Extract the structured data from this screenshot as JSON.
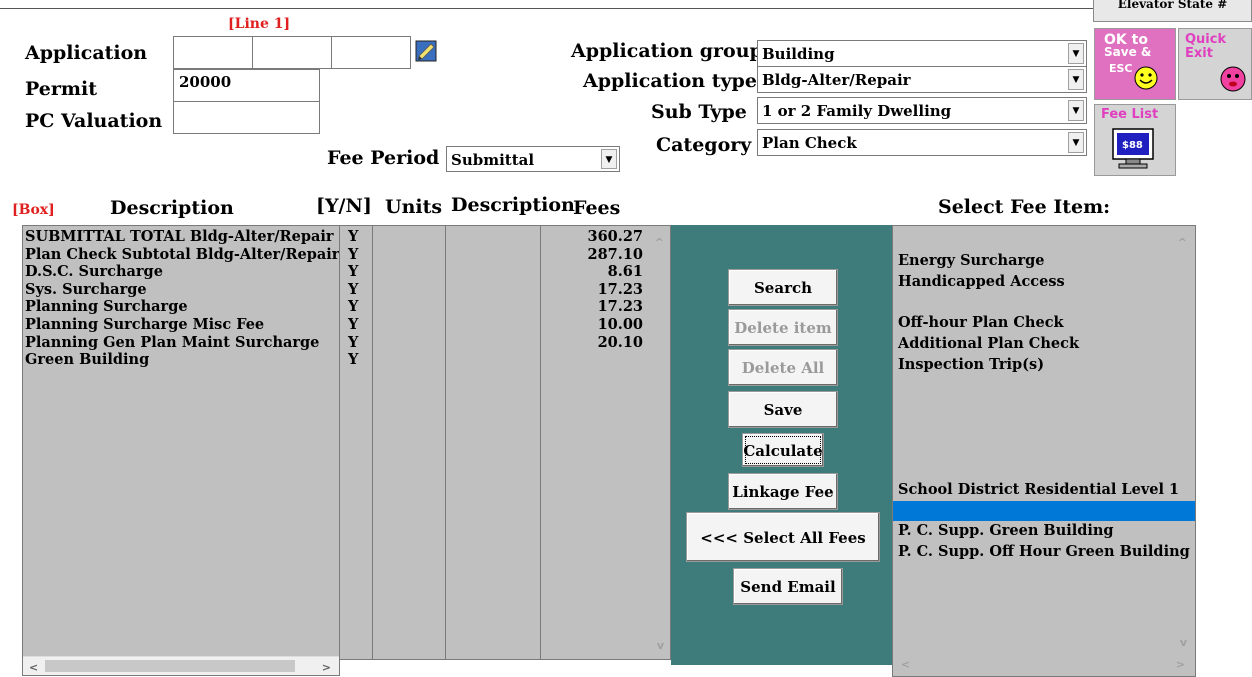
{
  "header": {
    "line1": "[Line 1]",
    "elevator_label": "Elevator State #"
  },
  "form": {
    "application_label": "Application",
    "permit_label": "Permit",
    "permit_value": "20000",
    "pc_valuation_label": "PC Valuation",
    "pc_valuation_value": "",
    "application_group_label": "Application group",
    "application_group_value": "Building",
    "application_type_label": "Application type",
    "application_type_value": "Bldg-Alter/Repair",
    "sub_type_label": "Sub Type",
    "sub_type_value": "1 or 2 Family Dwelling",
    "category_label": "Category",
    "category_value": "Plan Check",
    "fee_period_label": "Fee Period",
    "fee_period_value": "Submittal"
  },
  "side_buttons": {
    "ok_label_1": "OK to",
    "ok_label_2": "Save &",
    "ok_label_3": "ESC",
    "quick_label_1": "Quick",
    "quick_label_2": "Exit",
    "fee_list_label": "Fee List",
    "fee_list_screen": "$88"
  },
  "table": {
    "box_tag": "[Box]",
    "headers": {
      "description": "Description",
      "yn": "[Y/N]",
      "units": "Units",
      "description2": "Description",
      "fees": "Fees",
      "select_fee_item": "Select Fee Item:"
    },
    "rows": [
      {
        "description": "SUBMITTAL TOTAL Bldg-Alter/Repair",
        "yn": "Y",
        "fee": "360.27"
      },
      {
        "description": "Plan Check Subtotal Bldg-Alter/Repair",
        "yn": "Y",
        "fee": "287.10"
      },
      {
        "description": "D.S.C. Surcharge",
        "yn": "Y",
        "fee": "8.61"
      },
      {
        "description": "Sys. Surcharge",
        "yn": "Y",
        "fee": "17.23"
      },
      {
        "description": "Planning Surcharge",
        "yn": "Y",
        "fee": "17.23"
      },
      {
        "description": "Planning Surcharge Misc Fee",
        "yn": "Y",
        "fee": "10.00"
      },
      {
        "description": "Planning Gen Plan Maint Surcharge",
        "yn": "Y",
        "fee": "20.10"
      },
      {
        "description": "Green Building",
        "yn": "Y",
        "fee": ""
      }
    ]
  },
  "actions": {
    "search": "Search",
    "delete_item": "Delete item",
    "delete_all": "Delete All",
    "save": "Save",
    "calculate": "Calculate",
    "linkage_fee": "Linkage Fee",
    "select_all_fees": "<<< Select All Fees",
    "send_email": "Send Email"
  },
  "fee_items": [
    "Energy Surcharge",
    "Handicapped Access",
    "",
    "Off-hour Plan Check",
    "Additional Plan Check",
    "Inspection Trip(s)",
    "",
    "",
    "",
    "",
    "",
    "School District Residential Level 1",
    "",
    "P. C. Supp. Green Building",
    "P. C. Supp. Off Hour Green Building"
  ],
  "colors": {
    "panel_teal": "#3d7c7b",
    "list_gray": "#c0c0c0",
    "selection_blue": "#0078d7",
    "ok_pink": "#f0a0d0",
    "red_label": "#e02020"
  }
}
